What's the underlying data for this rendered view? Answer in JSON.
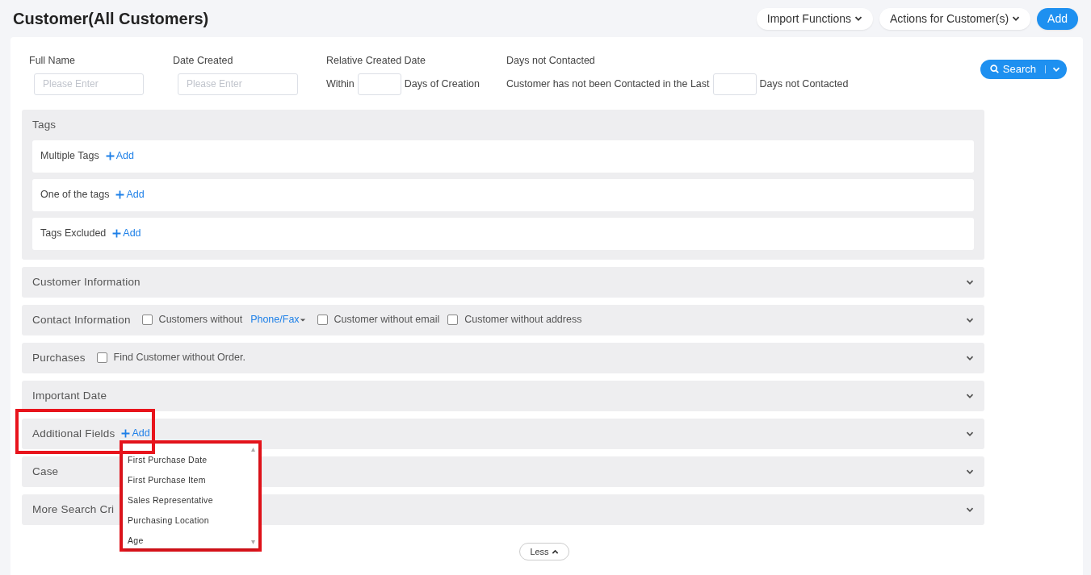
{
  "page_title": "Customer(All Customers)",
  "header_buttons": [
    {
      "label": "Import Functions",
      "kind": "menu"
    },
    {
      "label": "Actions for Customer(s)",
      "kind": "menu"
    },
    {
      "label": "Add",
      "kind": "primary"
    }
  ],
  "filters": [
    {
      "label": "Full Name",
      "parts": [
        {
          "kind": "input",
          "placeholder": "Please Enter"
        }
      ]
    },
    {
      "label": "Date Created",
      "parts": [
        {
          "kind": "input",
          "placeholder": "Please Enter"
        }
      ]
    },
    {
      "label": "Relative Created Date",
      "parts": [
        {
          "kind": "text",
          "text": "Within"
        },
        {
          "kind": "box"
        },
        {
          "kind": "text",
          "text": "Days of Creation"
        }
      ]
    },
    {
      "label": "Days not Contacted",
      "parts": [
        {
          "kind": "text",
          "text": "Customer has not been Contacted in the Last"
        },
        {
          "kind": "box"
        },
        {
          "kind": "text",
          "text": "Days not Contacted"
        }
      ]
    }
  ],
  "search_button": {
    "label": "Search"
  },
  "sections": [
    {
      "title": "Tags",
      "expanded": true,
      "rows": [
        {
          "label": "Multiple Tags",
          "add": "Add"
        },
        {
          "label": "One of the tags",
          "add": "Add"
        },
        {
          "label": "Tags Excluded",
          "add": "Add"
        }
      ]
    },
    {
      "title": "Customer Information",
      "expanded": false
    },
    {
      "title": "Contact Information",
      "expanded": false,
      "options": [
        {
          "kind": "checkbox",
          "label": "Customers without",
          "checked": false
        },
        {
          "kind": "link",
          "label": "Phone/Fax"
        },
        {
          "kind": "checkbox",
          "label": "Customer without email",
          "checked": false
        },
        {
          "kind": "checkbox",
          "label": "Customer without address",
          "checked": false
        }
      ]
    },
    {
      "title": "Purchases",
      "expanded": false,
      "options": [
        {
          "kind": "checkbox",
          "label": "Find Customer without Order.",
          "checked": false
        }
      ]
    },
    {
      "title": "Important Date",
      "expanded": false
    },
    {
      "title": "Additional Fields",
      "expanded": false,
      "add": "Add",
      "highlighted": true,
      "dropdown": {
        "highlighted": true,
        "items": [
          "First Purchase Date",
          "First Purchase Item",
          "Sales Representative",
          "Purchasing Location",
          "Age"
        ]
      }
    },
    {
      "title": "Case",
      "expanded": false
    },
    {
      "title": "More Search Cri",
      "expanded": false
    }
  ],
  "less_button": {
    "label": "Less"
  }
}
